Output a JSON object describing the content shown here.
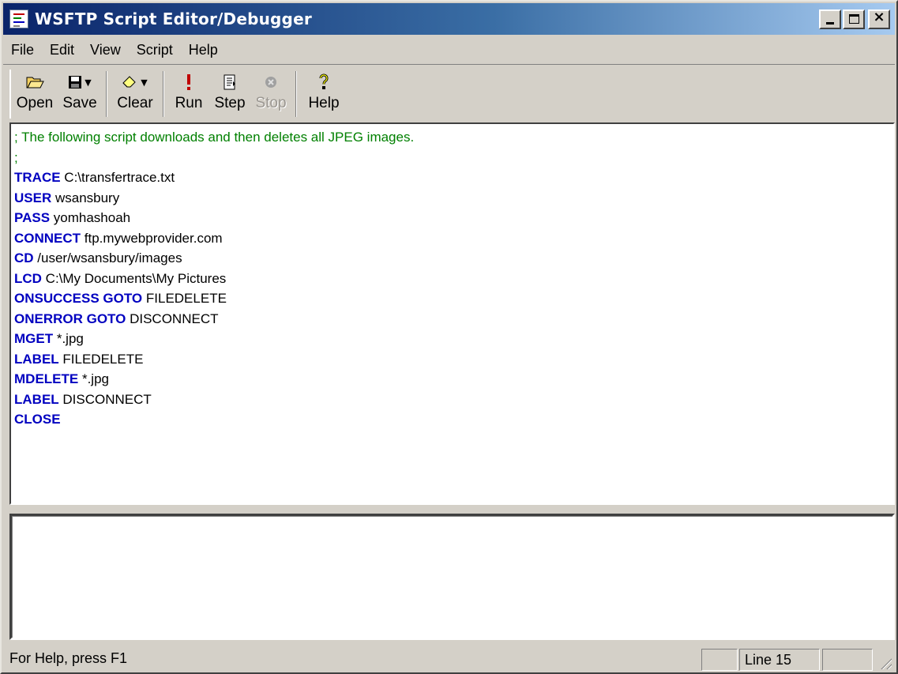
{
  "window": {
    "title": "WSFTP Script Editor/Debugger"
  },
  "menu": [
    "File",
    "Edit",
    "View",
    "Script",
    "Help"
  ],
  "toolbar": {
    "open": "Open",
    "save": "Save",
    "clear": "Clear",
    "run": "Run",
    "step": "Step",
    "stop": "Stop",
    "help": "Help"
  },
  "script_lines": [
    {
      "type": "comment",
      "text": "; The following script downloads and then deletes all JPEG images."
    },
    {
      "type": "comment",
      "text": ";"
    },
    {
      "type": "cmd",
      "keyword": "TRACE",
      "arg": " C:\\transfertrace.txt"
    },
    {
      "type": "cmd",
      "keyword": "USER",
      "arg": " wsansbury"
    },
    {
      "type": "cmd",
      "keyword": "PASS",
      "arg": " yomhashoah"
    },
    {
      "type": "cmd",
      "keyword": "CONNECT",
      "arg": " ftp.mywebprovider.com"
    },
    {
      "type": "cmd",
      "keyword": "CD",
      "arg": " /user/wsansbury/images"
    },
    {
      "type": "cmd",
      "keyword": "LCD",
      "arg": " C:\\My Documents\\My Pictures"
    },
    {
      "type": "cmd",
      "keyword": "ONSUCCESS GOTO",
      "arg": " FILEDELETE"
    },
    {
      "type": "cmd",
      "keyword": "ONERROR GOTO",
      "arg": " DISCONNECT"
    },
    {
      "type": "cmd",
      "keyword": "MGET",
      "arg": " *.jpg"
    },
    {
      "type": "cmd",
      "keyword": "LABEL",
      "arg": " FILEDELETE"
    },
    {
      "type": "cmd",
      "keyword": "MDELETE",
      "arg": " *.jpg"
    },
    {
      "type": "cmd",
      "keyword": "LABEL",
      "arg": " DISCONNECT"
    },
    {
      "type": "cmd",
      "keyword": "CLOSE",
      "arg": ""
    }
  ],
  "status": {
    "help_text": "For Help, press F1",
    "line": "Line 15"
  },
  "colors": {
    "keyword": "#0000c0",
    "comment": "#008000",
    "title_start": "#0a246a",
    "title_end": "#a6caf0"
  }
}
